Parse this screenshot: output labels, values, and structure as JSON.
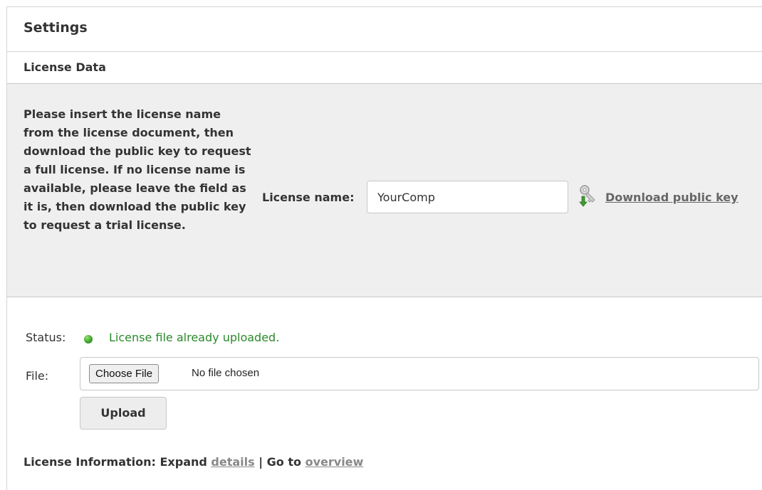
{
  "panel": {
    "title": "Settings"
  },
  "license_section": {
    "title": "License Data",
    "instructions": "Please insert the license name from the license document, then download the public key to request a full license. If no license name is available, please leave the field as it is, then download the public key to request a trial license.",
    "license_name_label": "License name:",
    "license_name_value": "YourComp",
    "download_link": "Download public key",
    "download_icon": "key-download-icon"
  },
  "upload_section": {
    "status_label": "Status:",
    "status_text": "License file already uploaded.",
    "status_color": "#2a8a2a",
    "file_label": "File:",
    "choose_file_button": "Choose File",
    "no_file_text": "No file chosen",
    "upload_button": "Upload"
  },
  "license_info": {
    "prefix": "License Information: Expand",
    "details_link": "details",
    "separator": "|",
    "goto_text": "Go to",
    "overview_link": "overview"
  }
}
